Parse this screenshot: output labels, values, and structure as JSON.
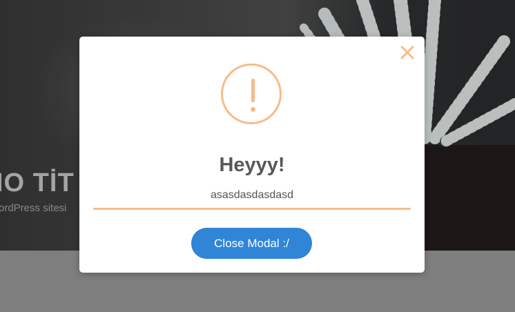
{
  "hero": {
    "title": "IO TİT",
    "subtitle": "ordPress sitesi"
  },
  "modal": {
    "icon": "warning-exclamation-icon",
    "close_icon": "close-icon",
    "title": "Heyyy!",
    "text": "asasdasdasdasd",
    "confirm_label": "Close Modal :/"
  },
  "colors": {
    "accent_warning": "#f8bb86",
    "button_primary": "#3085d6",
    "title_text": "#575757"
  }
}
